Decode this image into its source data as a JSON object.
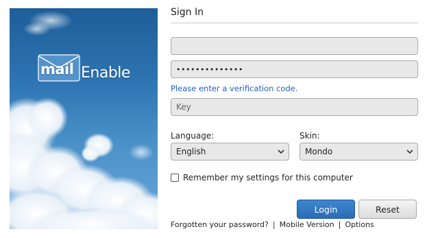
{
  "brand": {
    "logo_mail": "mail",
    "logo_enable": "Enable"
  },
  "form": {
    "title": "Sign In",
    "username_value": "",
    "password_value": "••••••••••••••",
    "verification_message": "Please enter a verification code.",
    "key_placeholder": "Key",
    "language_label": "Language:",
    "language_value": "English",
    "skin_label": "Skin:",
    "skin_value": "Mondo",
    "remember_label": "Remember my settings for this computer",
    "login_label": "Login",
    "reset_label": "Reset"
  },
  "footer_links": {
    "forgot": "Forgotten your password?",
    "separator": "|",
    "mobile": "Mobile Version",
    "options": "Options"
  },
  "colors": {
    "accent": "#2a6db5",
    "message": "#1f5fc7"
  },
  "icons": {
    "language_dropdown": "chevron-down-icon",
    "skin_dropdown": "chevron-down-icon",
    "logo": "envelope-icon"
  }
}
